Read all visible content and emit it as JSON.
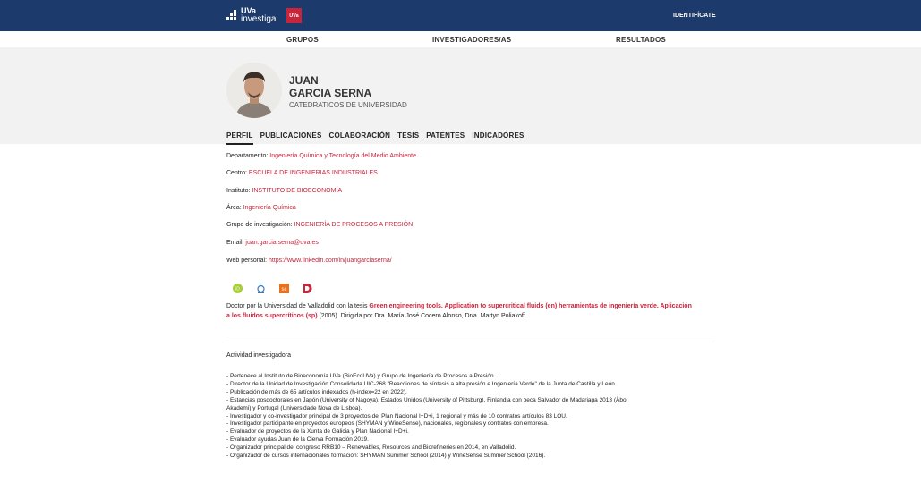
{
  "header": {
    "logo_line1": "UVa",
    "logo_line2": "investiga",
    "badge": "UVa",
    "identify_label": "IDENTIFÍCATE"
  },
  "nav": {
    "items": [
      "GRUPOS",
      "INVESTIGADORES/AS",
      "RESULTADOS"
    ]
  },
  "profile": {
    "first_name": "JUAN",
    "last_name": "GARCIA SERNA",
    "position": "CATEDRATICOS DE UNIVERSIDAD"
  },
  "tabs": [
    "PERFIL",
    "PUBLICACIONES",
    "COLABORACIÓN",
    "TESIS",
    "PATENTES",
    "INDICADORES"
  ],
  "fields": [
    {
      "label": "Departamento:",
      "value": "Ingeniería Química y Tecnología del Medio Ambiente"
    },
    {
      "label": "Centro:",
      "value": "ESCUELA DE INGENIERIAS INDUSTRIALES"
    },
    {
      "label": "Instituto:",
      "value": "INSTITUTO DE BIOECONOMÍA"
    },
    {
      "label": "Área:",
      "value": "Ingeniería Química"
    },
    {
      "label": "Grupo de investigación:",
      "value": "INGENIERÍA DE PROCESOS A PRESIÓN"
    },
    {
      "label": "Email:",
      "value": "juan.garcia.serna@uva.es"
    },
    {
      "label": "Web personal:",
      "value": "https://www.linkedin.com/in/juangarciaserna/"
    }
  ],
  "identifiers": [
    "orcid-icon",
    "researcherid-icon",
    "scopus-icon",
    "dialnet-icon"
  ],
  "colors": {
    "accent": "#c8243b",
    "header": "#1c3a6b"
  },
  "thesis": {
    "prefix": "Doctor por la Universidad de Valladolid con la tesis ",
    "title": "Green engineering tools. Application to supercritical fluids (en) herramientas de ingeniería verde. Aplicación a los fluidos supercríticos (sp)",
    "suffix": " (2005). Dirigida por Dra. María José Cocero Alonso, Dr/a. Martyn Poliakoff."
  },
  "research": {
    "heading": "Actividad investigadora",
    "items": [
      "- Pertenece al Instituto de Bioeconomía UVa (BioEcoUVa) y Grupo de Ingeniería de Procesos a Presión.",
      "- Director de la Unidad de Investigación Consolidada UIC-268 \"Reacciones de síntesis a alta presión e Ingeniería Verde\" de la Junta de Castilla y León.",
      "- Publicación de más de 65 artículos indexados (h-index=22 en 2022).",
      "- Estancias posdoctorales en Japón (University of Nagoya), Estados Unidos (University of Pittsburg), Finlandia con beca Salvador de Madariaga 2013 (Åbo",
      "Akademi) y Portugal (Universidade Nova de Lisboa).",
      "- Investigador y co-investigador principal de 3 proyectos del Plan Nacional I+D+i, 1 regional y más de 10 contratos artículos 83 LOU.",
      "- Investigador participante en proyectos europeos (SHYMAN y WineSense), nacionales, regionales y contratos con empresa.",
      "- Evaluador de proyectos de la Xunta de Galicia y Plan Nacional I+D+i.",
      "- Evaluador ayudas Juan de la Cierva Formación 2019.",
      "- Organizador principal del congreso RRB10 – Renewables, Resources and Biorefineries en 2014, en Valladolid.",
      "- Organizador de cursos internacionales formación: SHYMAN Summer School (2014) y WineSense Summer School (2016)."
    ]
  }
}
